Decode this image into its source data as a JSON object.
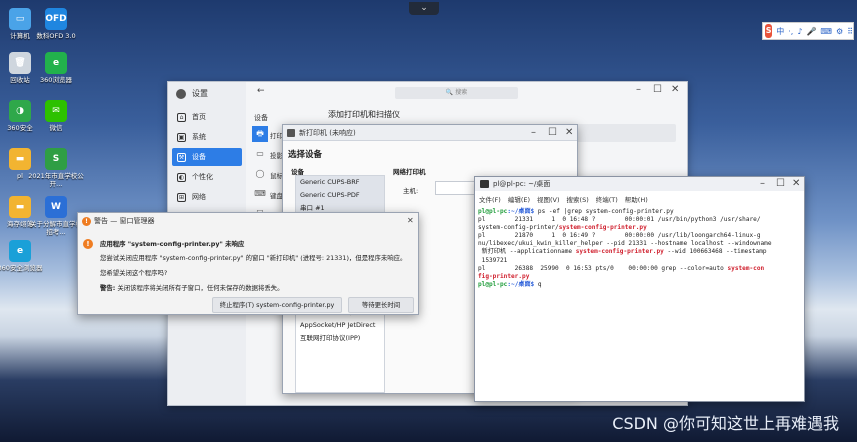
{
  "watermark": "CSDN @你可知这世上再难遇我",
  "topbar_arrow": "⌄",
  "tray": {
    "logo": "S",
    "items": [
      "中",
      "·,",
      "♪",
      "🎤",
      "⌨",
      "⚙",
      "⠿"
    ]
  },
  "desktop": {
    "icons": [
      {
        "label": "计算机",
        "glyph": "▭",
        "color": "#4aa3e8"
      },
      {
        "label": "数科OFD 3.0",
        "glyph": "OFD",
        "color": "#1f86e0"
      },
      {
        "label": "回收站",
        "glyph": "🗑",
        "color": "#cfd6de"
      },
      {
        "label": "360浏览器",
        "glyph": "e",
        "color": "#22b14c"
      },
      {
        "label": "360安全",
        "glyph": "◑",
        "color": "#2fa84a"
      },
      {
        "label": "微信",
        "glyph": "✉",
        "color": "#2dc100"
      },
      {
        "label": "pl",
        "glyph": "▬",
        "color": "#f2b431"
      },
      {
        "label": "2021年市直学校公开...",
        "glyph": "S",
        "color": "#2f9e44"
      },
      {
        "label": "海存翊蔼",
        "glyph": "▬",
        "color": "#f2b431"
      },
      {
        "label": "关于分解市直学校招考...",
        "glyph": "W",
        "color": "#2b6fd6"
      },
      {
        "label": "360安全浏览器",
        "glyph": "e",
        "color": "#1aa0d8"
      }
    ]
  },
  "settings": {
    "title": "设置",
    "search_placeholder": "搜索",
    "nav": [
      {
        "label": "首页",
        "icon": "⌂"
      },
      {
        "label": "系统",
        "icon": "▣"
      },
      {
        "label": "设备",
        "icon": "⚒"
      },
      {
        "label": "个性化",
        "icon": "◐"
      },
      {
        "label": "网络",
        "icon": "⊞"
      }
    ],
    "section": "设备",
    "heading": "添加打印机和扫描仪",
    "sub_items": [
      "打印",
      "投影",
      "鼠标",
      "键盘",
      "触控"
    ],
    "controls": [
      "–",
      "☐",
      "✕"
    ]
  },
  "new_printer": {
    "title": "新打印机 (未响应)",
    "heading": "选择设备",
    "device_label": "设备",
    "net_label": "网络打印机",
    "host_label": "主机:",
    "devices": [
      "Generic CUPS-BRF",
      "Generic CUPS-PDF",
      "串口 #1",
      "",
      "",
      "",
      "",
      "",
      "",
      "",
      "LPD/LPR 主机或者打印机",
      "AppSocket/HP JetDirect",
      "互联网打印协议(IPP)"
    ],
    "controls": [
      "–",
      "☐",
      "✕"
    ]
  },
  "warning": {
    "title": "警告 — 窗口管理器",
    "headline": "应用程序 \"system-config-printer.py\" 未响应",
    "line1": "您尝试关闭应用程序 \"system-config-printer.py\" 的窗口 \"新打印机\" (进程号: 21331)，但是程序未响应。",
    "line2": "您希望关闭这个程序吗?",
    "warn_prefix": "警告:",
    "warn_text": "关闭该程序将关闭所有子窗口，任何未保存的数据将丢失。",
    "btn_terminate": "终止程序(T) system-config-printer.py",
    "btn_wait": "等待更长时间",
    "close": "✕"
  },
  "terminal": {
    "title": "pl@pl-pc: ~/桌面",
    "menu": [
      "文件(F)",
      "编辑(E)",
      "视图(V)",
      "搜索(S)",
      "终端(T)",
      "帮助(H)"
    ],
    "prompt_user": "pl@pl-pc",
    "prompt_path": ":~/桌面$",
    "cmd1": " ps -ef |grep system-config-printer.py",
    "out1a": "pl        21331     1  0 16:48 ?        00:00:01 /usr/bin/python3 /usr/share/",
    "out1b": "system-config-printer/",
    "out1b_red": "system-config-printer.py",
    "out2a": "pl        21870     1  0 16:49 ?        00:00:00 /usr/lib/loongarch64-linux-g",
    "out2b": "nu/libexec/ukui_kwin_killer_helper --pid 21331 --hostname localhost --windowname",
    "out2c_pre": " 新打印机 --applicationname ",
    "out2c_red": "system-config-printer.py",
    "out2c_post": " --wid 100663468 --timestamp",
    "out2d": " 1539721",
    "out3a": "pl        26388  25990  0 16:53 pts/0    00:00:00 grep --color=auto ",
    "out3a_red": "system-con",
    "out3b_red": "fig-printer.py",
    "cmd2": " q",
    "controls": [
      "–",
      "☐",
      "✕"
    ]
  }
}
